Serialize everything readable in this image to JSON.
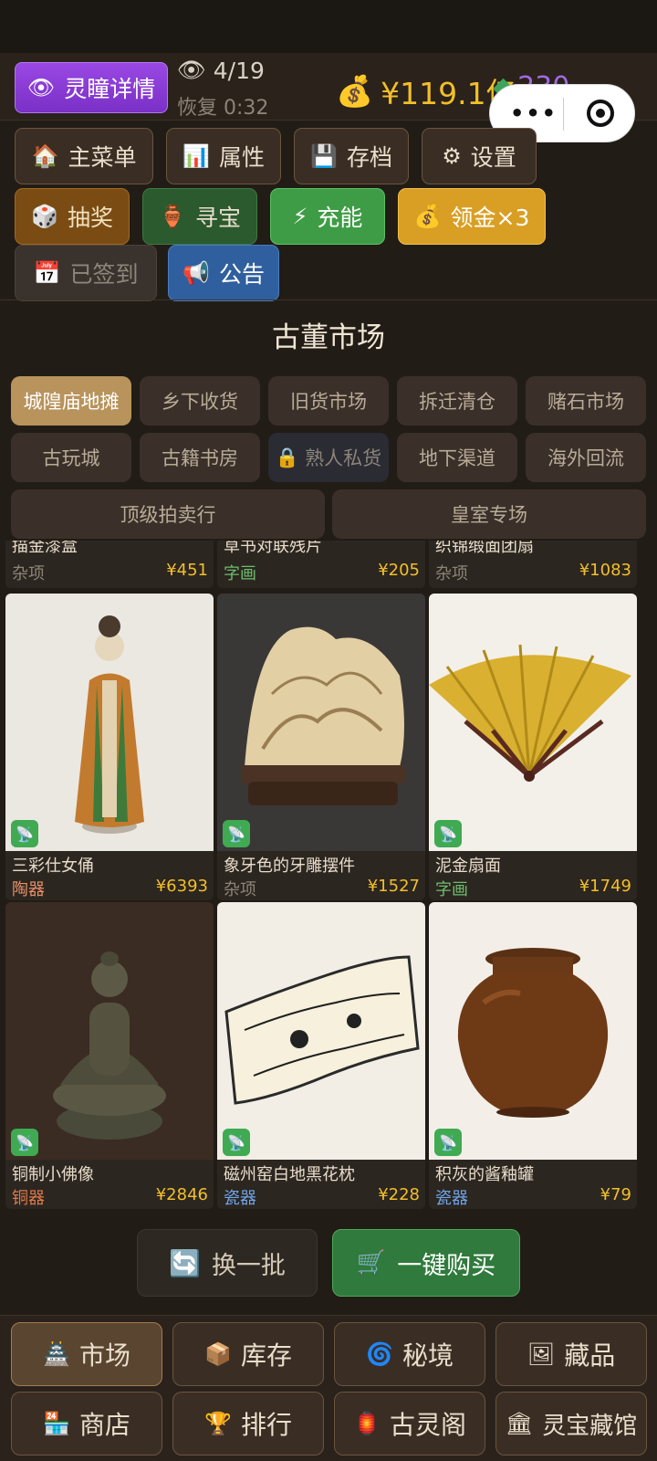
{
  "header": {
    "eye_button": "灵瞳详情",
    "eye_count": "4/19",
    "recover": "恢复 0:32",
    "money": "¥119.1亿",
    "gems": "230"
  },
  "toolbar": [
    {
      "label": "主菜单",
      "icon": "house-icon"
    },
    {
      "label": "属性",
      "icon": "chart-icon"
    },
    {
      "label": "存档",
      "icon": "floppy-icon"
    },
    {
      "label": "设置",
      "icon": "gear-icon"
    },
    {
      "label": "抽奖",
      "icon": "dice-icon"
    },
    {
      "label": "寻宝",
      "icon": "vase-icon"
    },
    {
      "label": "充能",
      "icon": "lightning-icon"
    },
    {
      "label": "领金×3",
      "icon": "moneybag-icon"
    },
    {
      "label": "已签到",
      "icon": "calendar-icon"
    },
    {
      "label": "公告",
      "icon": "megaphone-icon"
    }
  ],
  "market": {
    "title": "古董市场",
    "tabs": [
      "城隍庙地摊",
      "乡下收货",
      "旧货市场",
      "拆迁清仓",
      "赌石市场",
      "古玩城",
      "古籍书房",
      "熟人私货",
      "地下渠道",
      "海外回流",
      "顶级拍卖行",
      "皇室专场"
    ]
  },
  "partial_items": [
    {
      "name": "描金漆盒",
      "category": "杂项",
      "price": "¥451"
    },
    {
      "name": "草书对联残片",
      "category": "字画",
      "price": "¥205"
    },
    {
      "name": "织锦缎面团扇",
      "category": "杂项",
      "price": "¥1083"
    }
  ],
  "items": [
    {
      "name": "三彩仕女俑",
      "category": "陶器",
      "price": "¥6393"
    },
    {
      "name": "象牙色的牙雕摆件",
      "category": "杂项",
      "price": "¥1527"
    },
    {
      "name": "泥金扇面",
      "category": "字画",
      "price": "¥1749"
    },
    {
      "name": "铜制小佛像",
      "category": "铜器",
      "price": "¥2846"
    },
    {
      "name": "磁州窑白地黑花枕",
      "category": "瓷器",
      "price": "¥228"
    },
    {
      "name": "积灰的酱釉罐",
      "category": "瓷器",
      "price": "¥79"
    }
  ],
  "actions": {
    "refresh": "换一批",
    "buy_all": "一键购买"
  },
  "nav": [
    {
      "label": "市场"
    },
    {
      "label": "库存"
    },
    {
      "label": "秘境"
    },
    {
      "label": "藏品"
    },
    {
      "label": "商店"
    },
    {
      "label": "排行"
    },
    {
      "label": "古灵阁"
    },
    {
      "label": "灵宝藏馆"
    }
  ],
  "colors": {
    "gold": "#f2bf2a",
    "accent_purple": "#8a3cd6",
    "green": "#3f9c46"
  }
}
